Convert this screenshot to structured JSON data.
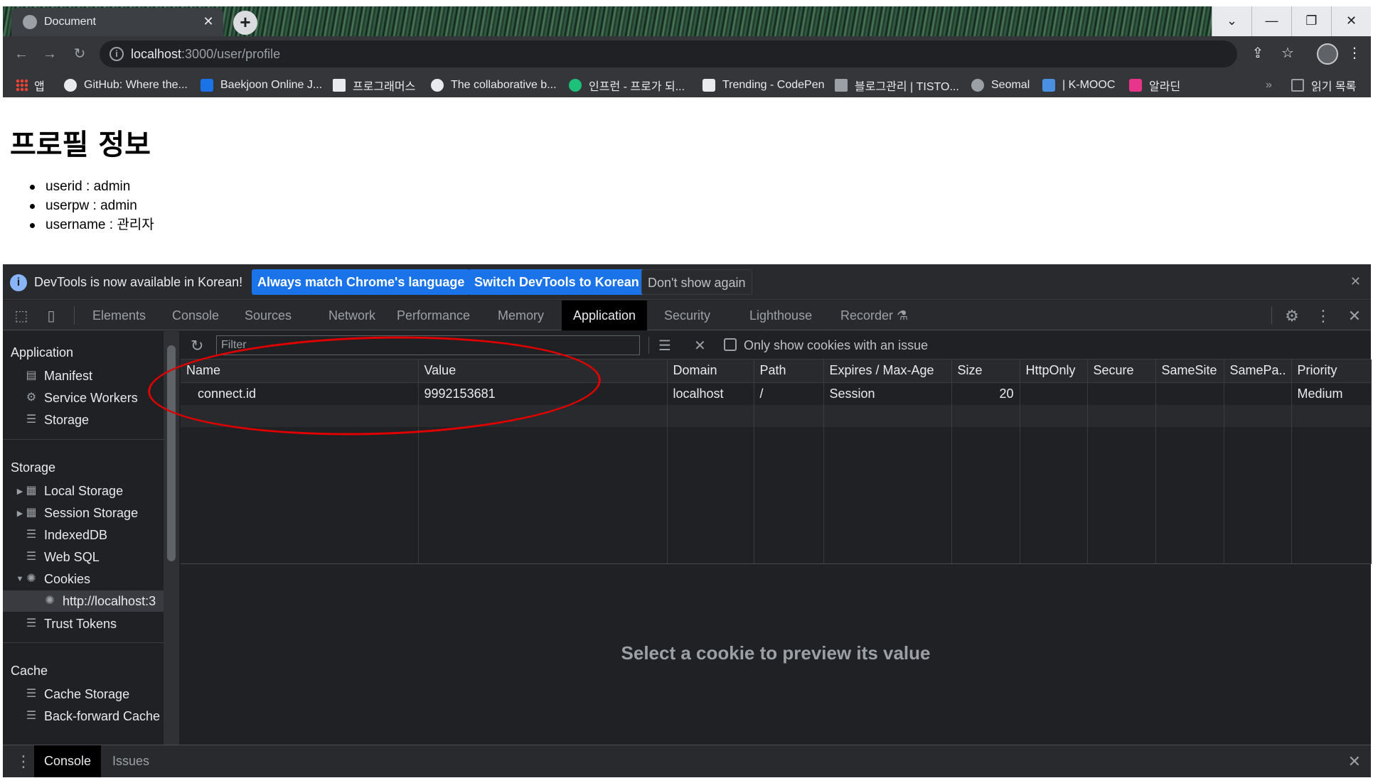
{
  "browser": {
    "tab_title": "Document",
    "tab_close": "✕",
    "new_tab": "+",
    "window_buttons": [
      "⌄",
      "—",
      "❐",
      "✕"
    ],
    "url_host": "localhost",
    "url_path": ":3000/user/profile",
    "bookmarks": [
      {
        "label": "앱",
        "icon": "apps-icon",
        "color": "#ea4335"
      },
      {
        "label": "GitHub: Where the...",
        "icon": "github-icon",
        "color": "#e8eaed"
      },
      {
        "label": "Baekjoon Online J...",
        "icon": "baekjoon-icon",
        "color": "#1a73e8"
      },
      {
        "label": "프로그래머스",
        "icon": "programmers-icon",
        "color": "#e8eaed"
      },
      {
        "label": "The collaborative b...",
        "icon": "collab-icon",
        "color": "#e8eaed"
      },
      {
        "label": "인프런 - 프로가 되...",
        "icon": "inflearn-icon",
        "color": "#1dc078"
      },
      {
        "label": "Trending - CodePen",
        "icon": "codepen-icon",
        "color": "#e8eaed"
      },
      {
        "label": "블로그관리 | TISTO...",
        "icon": "tistory-icon",
        "color": "#e8eaed"
      },
      {
        "label": "Seomal",
        "icon": "seomal-icon",
        "color": "#9aa0a6"
      },
      {
        "label": "| K-MOOC",
        "icon": "kmooc-icon",
        "color": "#4a90e2"
      },
      {
        "label": "알라딘",
        "icon": "aladin-icon",
        "color": "#e8358b"
      }
    ],
    "bookmarks_more": "»",
    "reading_list": "읽기 목록"
  },
  "page": {
    "title": "프로필 정보",
    "fields": [
      "userid : admin",
      "userpw : admin",
      "username : 관리자"
    ]
  },
  "devtools": {
    "infobar": {
      "message": "DevTools is now available in Korean!",
      "btn_match": "Always match Chrome's language",
      "btn_switch": "Switch DevTools to Korean",
      "btn_dismiss": "Don't show again",
      "close": "✕"
    },
    "tabs": [
      "Elements",
      "Console",
      "Sources",
      "Network",
      "Performance",
      "Memory",
      "Application",
      "Security",
      "Lighthouse",
      "Recorder"
    ],
    "active_tab": "Application",
    "sidebar": {
      "application_header": "Application",
      "application_items": [
        "Manifest",
        "Service Workers",
        "Storage"
      ],
      "storage_header": "Storage",
      "storage_items": [
        "Local Storage",
        "Session Storage",
        "IndexedDB",
        "Web SQL",
        "Cookies",
        "http://localhost:3",
        "Trust Tokens"
      ],
      "cache_header": "Cache",
      "cache_items": [
        "Cache Storage",
        "Back-forward Cache"
      ]
    },
    "cookies": {
      "filter_placeholder": "Filter",
      "only_issue_label": "Only show cookies with an issue",
      "columns": [
        "Name",
        "Value",
        "Domain",
        "Path",
        "Expires / Max-Age",
        "Size",
        "HttpOnly",
        "Secure",
        "SameSite",
        "SamePa..",
        "Priority"
      ],
      "rows": [
        {
          "name": "connect.id",
          "value": "9992153681",
          "domain": "localhost",
          "path": "/",
          "expires": "Session",
          "size": "20",
          "httponly": "",
          "secure": "",
          "samesite": "",
          "sameparty": "",
          "priority": "Medium"
        }
      ],
      "preview_placeholder": "Select a cookie to preview its value"
    },
    "drawer": {
      "tabs": [
        "Console",
        "Issues"
      ],
      "active": "Console",
      "close": "✕"
    }
  },
  "colors": {
    "annotation": "#e00000",
    "primary_button": "#1a73e8",
    "devtools_bg": "#202124"
  }
}
